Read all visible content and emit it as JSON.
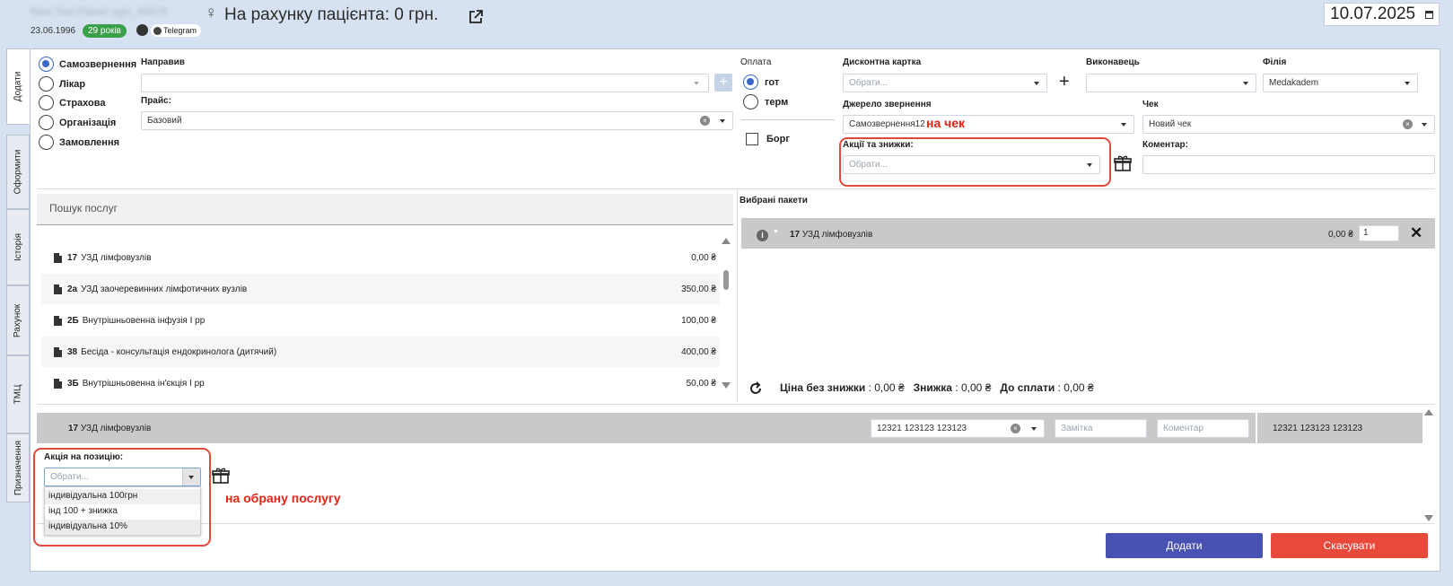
{
  "header": {
    "patient_name": "New Test Planet sgm_40479",
    "gender_symbol": "♀",
    "account_title": "На рахунку пацієнта: 0 грн.",
    "dob": "23.06.1996",
    "age_badge": "29 років",
    "telegram_label": "Telegram",
    "date": "10.07.2025"
  },
  "side_tabs": [
    "Додати",
    "Оформити",
    "Історія",
    "Рахунок",
    "ТМЦ",
    "Призначення"
  ],
  "source_type": {
    "options": [
      "Самозвернення",
      "Лікар",
      "Страхова",
      "Організація",
      "Замовлення"
    ],
    "selected": "Самозвернення"
  },
  "referrer": {
    "label": "Направив",
    "value": ""
  },
  "price": {
    "label": "Прайс:",
    "value": "Базовий"
  },
  "payment": {
    "label": "Оплата",
    "options": [
      "гот",
      "терм"
    ],
    "selected": "гот",
    "debt_label": "Борг"
  },
  "discount_card": {
    "label": "Дисконтна картка",
    "placeholder": "Обрати..."
  },
  "performer": {
    "label": "Виконавець",
    "value": ""
  },
  "branch": {
    "label": "Філія",
    "value": "Medakadem"
  },
  "appeal_source": {
    "label": "Джерело звернення",
    "value": "Самозвернення12"
  },
  "receipt": {
    "label": "Чек",
    "value": "Новий чек"
  },
  "promotions": {
    "label": "Акції та знижки:",
    "placeholder": "Обрати..."
  },
  "comment": {
    "label": "Коментар:",
    "value": ""
  },
  "annotations": {
    "receipt_note": "на чек",
    "service_note": "на обрану послугу"
  },
  "service_search": {
    "placeholder": "Пошук послуг"
  },
  "services": [
    {
      "code": "17",
      "name": "УЗД лімфовузлів",
      "price": "0,00 ₴"
    },
    {
      "code": "2а",
      "name": "УЗД заочеревинних лімфотичних вузлів",
      "price": "350,00 ₴"
    },
    {
      "code": "2Б",
      "name": "Внутрішньовенна інфузія І рр",
      "price": "100,00 ₴"
    },
    {
      "code": "38",
      "name": "Бесіда - консультація ендокринолога (дитячий)",
      "price": "400,00 ₴"
    },
    {
      "code": "3Б",
      "name": "Внутрішньовенна ін'єкція І рр",
      "price": "50,00 ₴"
    }
  ],
  "selected_packages": {
    "label": "Вибрані пакети",
    "items": [
      {
        "code": "17",
        "name": "УЗД лімфовузлів",
        "price": "0,00 ₴",
        "qty": "1"
      }
    ]
  },
  "totals": {
    "no_discount_label": "Ціна без знижки",
    "no_discount_value": "0,00 ₴",
    "discount_label": "Знижка",
    "discount_value": "0,00 ₴",
    "to_pay_label": "До сплати",
    "to_pay_value": "0,00 ₴"
  },
  "position": {
    "code": "17",
    "name": "УЗД лімфовузлів",
    "staff": "12321 123123 123123",
    "note_placeholder": "Замітка",
    "comment_placeholder": "Коментар",
    "staff_display": "12321 123123 123123",
    "promo_label": "Акція на позицію:",
    "promo_placeholder": "Обрати...",
    "promo_options": [
      "індивідуальна 100грн",
      "інд 100 + знижка",
      "індивідуальна 10%"
    ]
  },
  "buttons": {
    "add": "Додати",
    "cancel": "Скасувати"
  },
  "colors": {
    "add_button": "#4752b3",
    "cancel_button": "#e8493b",
    "accent": "#3b67c9",
    "age_badge": "#3aa14a",
    "annotation": "#e52313"
  }
}
